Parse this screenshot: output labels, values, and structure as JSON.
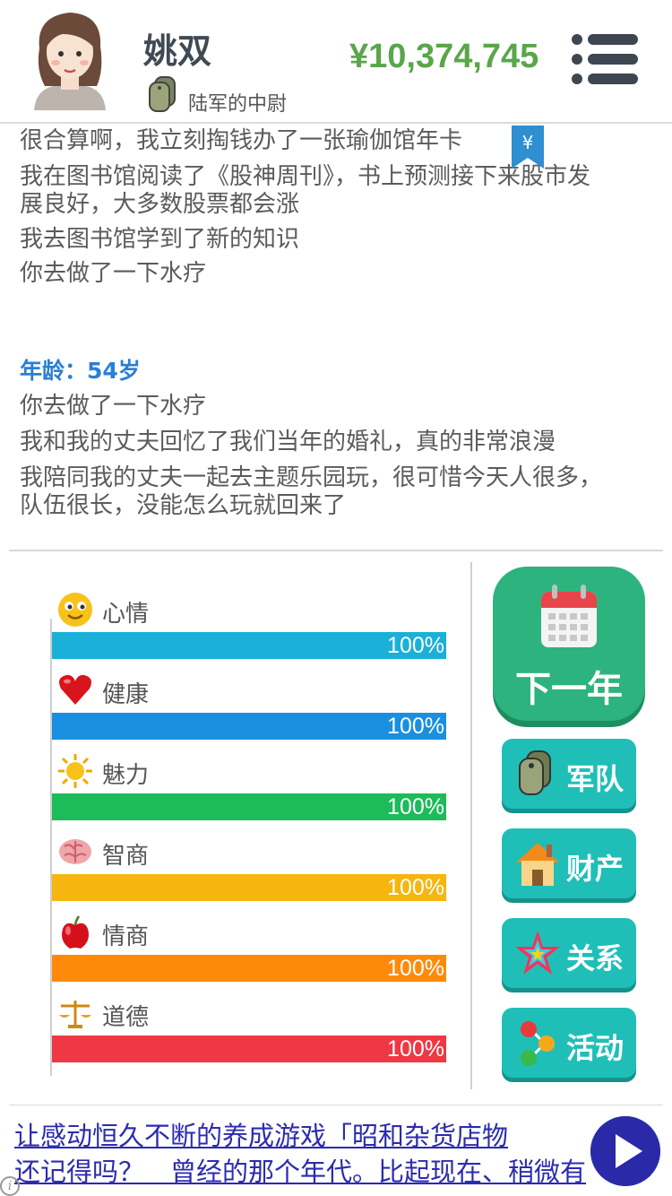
{
  "header": {
    "name": "姚双",
    "rank": "陆军的中尉",
    "money": "¥10,374,745",
    "menu_icon": "hamburger-menu-icon"
  },
  "log": {
    "lines_top": [
      "很合算啊，我立刻掏钱办了一张瑜伽馆年卡",
      "我在图书馆阅读了《股神周刊》，书上预测接下来股市发",
      "展良好，大多数股票都会涨",
      "我去图书馆学到了新的知识",
      "你去做了一下水疗"
    ],
    "age_label": "年龄：54岁",
    "lines_age": [
      "你去做了一下水疗",
      "我和我的丈夫回忆了我们当年的婚礼，真的非常浪漫",
      "我陪同我的丈夫一起去主题乐园玩，很可惜今天人很多，",
      "队伍很长，没能怎么玩就回来了"
    ],
    "bookmark_symbol": "¥"
  },
  "stats": [
    {
      "label": "心情",
      "value": 100,
      "pct": "100%",
      "color": "#1ab0d8",
      "icon": "smiley-icon"
    },
    {
      "label": "健康",
      "value": 100,
      "pct": "100%",
      "color": "#1a8fe0",
      "icon": "heart-icon"
    },
    {
      "label": "魅力",
      "value": 100,
      "pct": "100%",
      "color": "#1dbb5a",
      "icon": "sun-icon"
    },
    {
      "label": "智商",
      "value": 100,
      "pct": "100%",
      "color": "#f6b60f",
      "icon": "brain-icon"
    },
    {
      "label": "情商",
      "value": 100,
      "pct": "100%",
      "color": "#ff8a0a",
      "icon": "apple-icon"
    },
    {
      "label": "道德",
      "value": 100,
      "pct": "100%",
      "color": "#ef3844",
      "icon": "scales-icon"
    }
  ],
  "actions": {
    "next_year": "下一年",
    "army": "军队",
    "assets": "财产",
    "relations": "关系",
    "activities": "活动"
  },
  "ad": {
    "line1": "让感动恒久不断的养成游戏「昭和杂货店物",
    "line2": "还记得吗？　曾经的那个年代。比起现在、稍微有",
    "info": "i"
  },
  "colors": {
    "money": "#5aa64a",
    "age": "#2a7fd4",
    "next_year_button": "#2db37e",
    "side_buttons": "#1fbfb8",
    "ad_link": "#2b2bb0"
  }
}
